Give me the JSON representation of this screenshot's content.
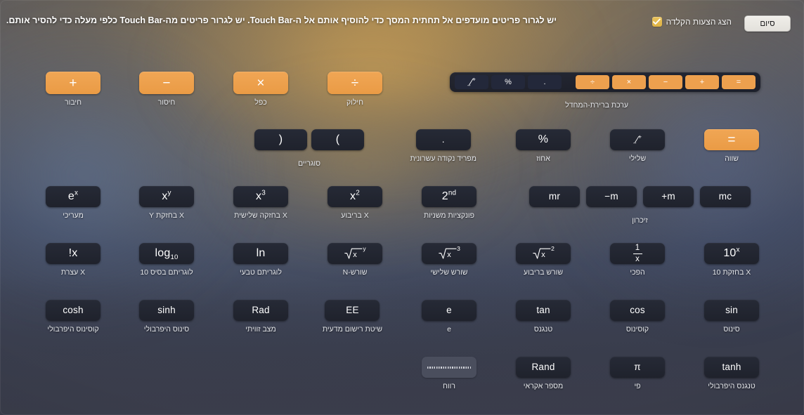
{
  "header": {
    "instructions": "יש לגרור פריטים מועדפים אל תחתית המסך כדי להוסיף אותם אל ה-Touch Bar. יש לגרור פריטים מה-Touch Bar כלפי מעלה כדי להסיר אותם.",
    "keyboard_suggestions_label": "הצג הצעות הקלדה",
    "keyboard_suggestions_checked": true,
    "done_label": "סיום"
  },
  "touch_bar": {
    "caption": "ערכת ברירת-המחדל",
    "keys": [
      {
        "glyph": "=",
        "style": "orange",
        "name": "equals"
      },
      {
        "glyph": "+",
        "style": "orange",
        "name": "plus"
      },
      {
        "glyph": "−",
        "style": "orange",
        "name": "minus"
      },
      {
        "glyph": "×",
        "style": "orange",
        "name": "multiply"
      },
      {
        "glyph": "÷",
        "style": "orange",
        "name": "divide"
      },
      {
        "glyph": ".",
        "style": "dark",
        "name": "decimal"
      },
      {
        "glyph": "%",
        "style": "dark",
        "name": "percent"
      },
      {
        "glyph": "⁺∕₋",
        "style": "dark",
        "name": "plus-minus"
      }
    ]
  },
  "items": {
    "add": {
      "glyph": "+",
      "caption": "חיבור"
    },
    "subtract": {
      "glyph": "−",
      "caption": "חיסור"
    },
    "multiply": {
      "glyph": "×",
      "caption": "כפל"
    },
    "divide": {
      "glyph": "÷",
      "caption": "חילוק"
    },
    "paren_open": {
      "glyph": "(",
      "caption": ""
    },
    "paren_close": {
      "glyph": ")",
      "caption": ""
    },
    "parens_caption": "סוגריים",
    "decimal": {
      "glyph": ".",
      "caption": "מפריד נקודה עשרונית"
    },
    "percent": {
      "glyph": "%",
      "caption": "אחוז"
    },
    "plusminus": {
      "glyph": "+/−",
      "caption": "שלילי"
    },
    "equals": {
      "glyph": "=",
      "caption": "שווה"
    },
    "exp": {
      "base": "e",
      "sup": "x",
      "caption": "מעריכי"
    },
    "xpowy": {
      "base": "x",
      "sup": "y",
      "caption": "X בחזקת Y"
    },
    "xpow3": {
      "base": "x",
      "sup": "3",
      "caption": "X בחזקה שלישית"
    },
    "xpow2": {
      "base": "x",
      "sup": "2",
      "caption": "X בריבוע"
    },
    "second": {
      "base": "2",
      "sup": "nd",
      "caption": "פונקציות משניות"
    },
    "mr": {
      "glyph": "mr",
      "caption": ""
    },
    "mminus": {
      "glyph": "m−",
      "caption": ""
    },
    "mplus": {
      "glyph": "m+",
      "caption": ""
    },
    "mc": {
      "glyph": "mc",
      "caption": ""
    },
    "memory_caption": "זיכרון",
    "factorial": {
      "glyph": "x!",
      "caption": "X עצרת"
    },
    "log10": {
      "base": "log",
      "sub": "10",
      "caption": "לוגריתם בסיס 10"
    },
    "ln": {
      "glyph": "ln",
      "caption": "לוגריתם טבעי"
    },
    "nroot": {
      "index": "y",
      "radicand": "x",
      "caption": "שורש-N"
    },
    "cuberoot": {
      "index": "3",
      "radicand": "x",
      "caption": "שורש שלישי"
    },
    "sqrt": {
      "index": "2",
      "radicand": "x",
      "caption": "שורש בריבוע"
    },
    "reciprocal": {
      "num": "1",
      "den": "x",
      "caption": "הפכי"
    },
    "tenpowx": {
      "base": "10",
      "sup": "x",
      "caption": "X בחזקת 10"
    },
    "cosh": {
      "glyph": "cosh",
      "caption": "קוסינוס היפרבולי"
    },
    "sinh": {
      "glyph": "sinh",
      "caption": "סינוס היפרבולי"
    },
    "rad": {
      "glyph": "Rad",
      "caption": "מצב זוויתי"
    },
    "ee": {
      "glyph": "EE",
      "caption": "שיטת רישום מדעית"
    },
    "e": {
      "glyph": "e",
      "caption": "e"
    },
    "tan": {
      "glyph": "tan",
      "caption": "טנגנס"
    },
    "cos": {
      "glyph": "cos",
      "caption": "קוסינוס"
    },
    "sin": {
      "glyph": "sin",
      "caption": "סינוס"
    },
    "space": {
      "glyph": "",
      "caption": "רווח"
    },
    "rand": {
      "glyph": "Rand",
      "caption": "מספר אקראי"
    },
    "pi": {
      "glyph": "π",
      "caption": "פי"
    },
    "tanh": {
      "glyph": "tanh",
      "caption": "טנגנס היפרבולי"
    }
  },
  "colors": {
    "accent_orange": "#eda04e",
    "key_dark": "#23283a",
    "checkbox_yellow": "#e2b74a"
  }
}
